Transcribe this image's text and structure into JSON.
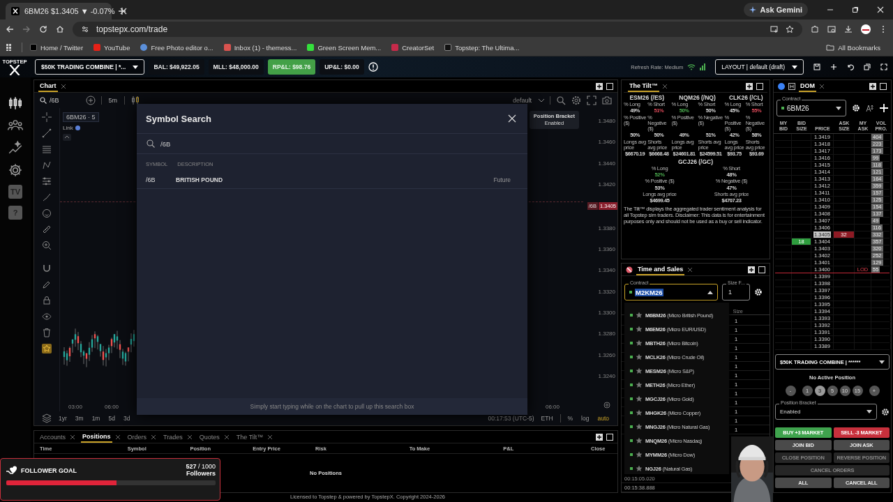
{
  "browser": {
    "tab_title": "6BM26 $1.3405 ▼ -0.07%",
    "url": "topstepx.com/trade",
    "ask_button": "Ask Gemini",
    "bookmarks": [
      "Home / Twitter",
      "YouTube",
      "Free Photo editor o...",
      "Inbox (1) - themess...",
      "Green Screen Mem...",
      "CreatorSet",
      "Topstep: The Ultima..."
    ],
    "all_bookmarks": "All Bookmarks"
  },
  "logo": "TOPSTEP",
  "toolbar": {
    "account": "$50K TRADING COMBINE | *...",
    "stats": [
      {
        "text": "BAL: $49,922.05",
        "highlighted": false
      },
      {
        "text": "MLL: $48,000.00",
        "highlighted": false
      },
      {
        "text": "RP&L: $98.76",
        "highlighted": true
      },
      {
        "text": "UP&L: $0.00",
        "highlighted": false
      }
    ],
    "refresh": "Refresh Rate: Medium",
    "layout": "LAYOUT | default (draft)"
  },
  "nav": [
    {
      "kind": "candles"
    },
    {
      "kind": "people"
    },
    {
      "kind": "sparkle"
    },
    {
      "kind": "gear"
    },
    {
      "kind": "badge",
      "label": "TV"
    },
    {
      "kind": "badge",
      "label": "?"
    }
  ],
  "chart": {
    "tab": "Chart",
    "symbol": "/6B",
    "interval": "5m",
    "template": "default",
    "legend": "6BM26 · 5",
    "link": "Link",
    "price_labels": [
      {
        "kind": "tick",
        "text": "1.3480"
      },
      {
        "kind": "tick",
        "text": "1.3460"
      },
      {
        "kind": "tick",
        "text": "1.3440"
      },
      {
        "kind": "tick",
        "text": "1.3420"
      },
      {
        "kind": "current",
        "symbol": "/6B",
        "text": "1.3405"
      },
      {
        "kind": "tick",
        "text": "1.3380"
      },
      {
        "kind": "tick",
        "text": "1.3360"
      },
      {
        "kind": "tick",
        "text": "1.3340"
      },
      {
        "kind": "tick",
        "text": "1.3320"
      },
      {
        "kind": "tick",
        "text": "1.3300"
      },
      {
        "kind": "tick",
        "text": "1.3280"
      },
      {
        "kind": "tick",
        "text": "1.3260"
      },
      {
        "kind": "tick",
        "text": "1.3240"
      }
    ],
    "time_labels_left": [
      "03:00",
      "06:00"
    ],
    "time_labels_right": [
      "06:00"
    ],
    "ranges": [
      "1yr",
      "3m",
      "1m",
      "5d",
      "3d"
    ],
    "clock": "00:17:53 (UTC-5)",
    "session": "ETH",
    "scale_options": [
      {
        "text": "%",
        "selected": false
      },
      {
        "text": "log",
        "selected": false
      },
      {
        "text": "auto",
        "selected": true
      }
    ],
    "tooltip": {
      "title": "Position Bracket",
      "text": "Enabled"
    }
  },
  "modal": {
    "title": "Symbol Search",
    "query": "/6B",
    "columns": [
      "SYMBOL",
      "DESCRIPTION"
    ],
    "results": [
      {
        "symbol": "/6B",
        "description": "BRITISH POUND",
        "type": "Future"
      }
    ],
    "hint": "Simply start typing while on the chart to pull up this search box"
  },
  "tilt": {
    "title": "The Tilt™",
    "groups": [
      {
        "symbol": "ESM26 (/ES)",
        "cells": [
          {
            "label": "% Long",
            "value": "49%",
            "highlighted": false
          },
          {
            "label": "% Short",
            "value": "51%",
            "highlighted": true
          },
          {
            "label": "% Positive ($)",
            "value": "50%",
            "highlighted": false
          },
          {
            "label": "% Negative ($)",
            "value": "50%",
            "highlighted": false
          },
          {
            "label": "Longs avg price",
            "value": "$6670.19",
            "highlighted": false
          },
          {
            "label": "Shorts avg price",
            "value": "$6668.48",
            "highlighted": false
          }
        ]
      },
      {
        "symbol": "NQM26 (/NQ)",
        "cells": [
          {
            "label": "% Long",
            "value": "50%",
            "highlighted": true
          },
          {
            "label": "% Short",
            "value": "50%",
            "highlighted": false
          },
          {
            "label": "% Positive ($)",
            "value": "49%",
            "highlighted": false
          },
          {
            "label": "% Negative ($)",
            "value": "51%",
            "highlighted": false
          },
          {
            "label": "Longs avg price",
            "value": "$24601.81",
            "highlighted": false
          },
          {
            "label": "Shorts avg price",
            "value": "$24599.51",
            "highlighted": false
          }
        ]
      },
      {
        "symbol": "CLK26 (/CL)",
        "cells": [
          {
            "label": "% Long",
            "value": "45%",
            "highlighted": false
          },
          {
            "label": "% Short",
            "value": "55%",
            "highlighted": true
          },
          {
            "label": "% Positive ($)",
            "value": "42%",
            "highlighted": false
          },
          {
            "label": "% Negative ($)",
            "value": "58%",
            "highlighted": false
          },
          {
            "label": "Longs avg price",
            "value": "$93.75",
            "highlighted": false
          },
          {
            "label": "Shorts avg price",
            "value": "$93.69",
            "highlighted": false
          }
        ]
      },
      {
        "symbol": "GCJ26 (/GC)",
        "cells": [
          {
            "label": "% Long",
            "value": "52%",
            "highlighted": true
          },
          {
            "label": "% Short",
            "value": "48%",
            "highlighted": false
          },
          {
            "label": "% Positive ($)",
            "value": "53%",
            "highlighted": false
          },
          {
            "label": "% Negative ($)",
            "value": "47%",
            "highlighted": false
          },
          {
            "label": "Longs avg price",
            "value": "$4699.45",
            "highlighted": false
          },
          {
            "label": "Shorts avg price",
            "value": "$4707.23",
            "highlighted": false
          }
        ]
      }
    ],
    "disclaimer": "The Tilt™ displays the aggregated trader sentiment analysis for all Topstep sim traders. Disclaimer: This data is for entertainment purposes only and should not be used as a buy or sell indicator."
  },
  "time_sales": {
    "title": "Time and Sales",
    "contract_label": "Contract",
    "contract": "M2KM26",
    "size_label": "Size F...",
    "size": "1",
    "column": "Size",
    "sizes": [
      "1",
      "1",
      "1",
      "1",
      "1",
      "1",
      "1",
      "1",
      "1",
      "1",
      "1",
      "1",
      "1"
    ],
    "times": [
      "00:15:05.020",
      "00:15:38.888"
    ],
    "dropdown": [
      {
        "symbol": "M6BM26",
        "description": "(Micro British Pound)"
      },
      {
        "symbol": "M6EM26",
        "description": "(Micro EUR/USD)"
      },
      {
        "symbol": "MBTH26",
        "description": "(Micro Bitcoin)"
      },
      {
        "symbol": "MCLK26",
        "description": "(Micro Crude Oil)"
      },
      {
        "symbol": "MESM26",
        "description": "(Micro S&P)"
      },
      {
        "symbol": "METH26",
        "description": "(Micro Ether)"
      },
      {
        "symbol": "MGCJ26",
        "description": "(Micro Gold)"
      },
      {
        "symbol": "MHGK26",
        "description": "(Micro Copper)"
      },
      {
        "symbol": "MNGJ26",
        "description": "(Micro Natural Gas)"
      },
      {
        "symbol": "MNQM26",
        "description": "(Micro Nasdaq)"
      },
      {
        "symbol": "MYMM26",
        "description": "(Micro Dow)"
      },
      {
        "symbol": "NGJ26",
        "description": "(Natural Gas)"
      }
    ]
  },
  "dom": {
    "title": "DOM",
    "contract_label": "Contract",
    "contract": "6BM26",
    "columns": [
      "MY BID",
      "BID SIZE",
      "PRICE",
      "ASK SIZE",
      "MY ASK",
      "VOL PRO."
    ],
    "rows": [
      {
        "price": "1.3419",
        "vol": "404",
        "last": false
      },
      {
        "price": "1.3418",
        "vol": "223",
        "last": false
      },
      {
        "price": "1.3417",
        "vol": "173",
        "last": false
      },
      {
        "price": "1.3416",
        "vol": "99",
        "last": false
      },
      {
        "price": "1.3415",
        "vol": "118",
        "last": false
      },
      {
        "price": "1.3414",
        "vol": "121",
        "last": false
      },
      {
        "price": "1.3413",
        "vol": "164",
        "last": false
      },
      {
        "price": "1.3412",
        "vol": "359",
        "last": false
      },
      {
        "price": "1.3411",
        "vol": "157",
        "last": false
      },
      {
        "price": "1.3410",
        "vol": "125",
        "last": false
      },
      {
        "price": "1.3409",
        "vol": "154",
        "last": false
      },
      {
        "price": "1.3408",
        "vol": "137",
        "last": false
      },
      {
        "price": "1.3407",
        "vol": "49",
        "last": false
      },
      {
        "price": "1.3406",
        "vol": "116",
        "last": false
      },
      {
        "price": "1.3405",
        "ask": "32",
        "vol": "332",
        "last": true
      },
      {
        "price": "1.3404",
        "bid": "18",
        "vol": "357",
        "last": false
      },
      {
        "price": "1.3403",
        "vol": "320",
        "last": false
      },
      {
        "price": "1.3402",
        "vol": "252",
        "last": false
      },
      {
        "price": "1.3401",
        "vol": "129",
        "last": false
      },
      {
        "price": "1.3400",
        "note": "LOD",
        "vol": "55",
        "last": false
      },
      {
        "price": "1.3399",
        "last": false
      },
      {
        "price": "1.3398",
        "last": false
      },
      {
        "price": "1.3397",
        "last": false
      },
      {
        "price": "1.3396",
        "last": false
      },
      {
        "price": "1.3395",
        "last": false
      },
      {
        "price": "1.3394",
        "last": false
      },
      {
        "price": "1.3393",
        "last": false
      },
      {
        "price": "1.3392",
        "last": false
      },
      {
        "price": "1.3391",
        "last": false
      },
      {
        "price": "1.3390",
        "last": false
      },
      {
        "price": "1.3389",
        "last": false
      }
    ],
    "account": "$50K TRADING COMBINE | ******",
    "position": "No Active Position",
    "quantities": [
      {
        "text": "-",
        "selected": false
      },
      {
        "text": "1",
        "selected": false
      },
      {
        "text": "3",
        "selected": true
      },
      {
        "text": "5",
        "selected": false
      },
      {
        "text": "10",
        "selected": false
      },
      {
        "text": "15",
        "selected": false
      },
      {
        "text": "+",
        "selected": false
      }
    ],
    "bracket_label": "Position Bracket",
    "bracket": "Enabled",
    "buttons": [
      {
        "label": "BUY +3 MARKET",
        "kind": "buy"
      },
      {
        "label": "SELL -3 MARKET",
        "kind": "sell"
      },
      {
        "label": "JOIN BID",
        "kind": "neutral"
      },
      {
        "label": "JOIN ASK",
        "kind": "neutral"
      },
      {
        "label": "CLOSE POSITION",
        "kind": "disabled"
      },
      {
        "label": "REVERSE POSITION",
        "kind": "disabled"
      },
      {
        "label": "CANCEL ORDERS",
        "kind": "disabled-wide"
      },
      {
        "label": "ALL",
        "kind": "neutral"
      },
      {
        "label": "CANCEL ALL",
        "kind": "neutral"
      }
    ]
  },
  "bottom": {
    "tabs": [
      {
        "label": "Accounts",
        "selected": false
      },
      {
        "label": "Positions",
        "selected": true
      },
      {
        "label": "Orders",
        "selected": false
      },
      {
        "label": "Trades",
        "selected": false
      },
      {
        "label": "Quotes",
        "selected": false
      },
      {
        "label": "The Tilt™",
        "selected": false
      }
    ],
    "columns": [
      "Time",
      "Symbol",
      "Position",
      "Entry Price",
      "Risk",
      "To Make",
      "P&L",
      "Close"
    ],
    "empty": "No Positions"
  },
  "footer": "Licensed to Topstep & powered by TopstepX. Copyright 2024-2026",
  "follower_goal": {
    "title": "FOLLOWER GOAL",
    "count": "**527** / 1000",
    "unit": "Followers",
    "level": 0.527
  }
}
